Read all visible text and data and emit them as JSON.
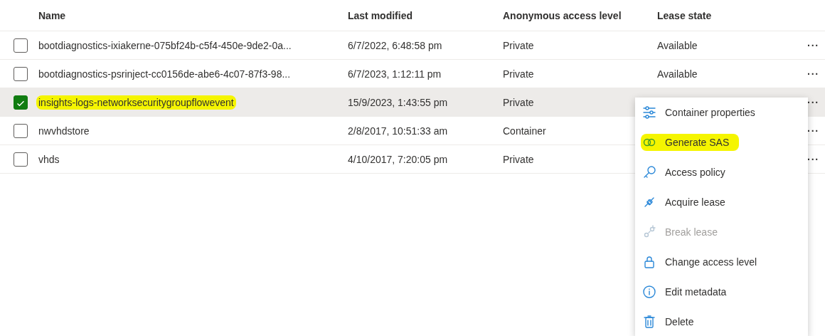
{
  "table": {
    "columns": [
      "Name",
      "Last modified",
      "Anonymous access level",
      "Lease state"
    ],
    "rows": [
      {
        "name": "bootdiagnostics-ixiakerne-075bf24b-c5f4-450e-9de2-0a...",
        "modified": "6/7/2022, 6:48:58 pm",
        "access": "Private",
        "lease": "Available",
        "more": "···",
        "selected": false,
        "highlighted": false
      },
      {
        "name": "bootdiagnostics-psrinject-cc0156de-abe6-4c07-87f3-98...",
        "modified": "6/7/2023, 1:12:11 pm",
        "access": "Private",
        "lease": "Available",
        "more": "···",
        "selected": false,
        "highlighted": false
      },
      {
        "name": "insights-logs-networksecuritygroupflowevent",
        "modified": "15/9/2023, 1:43:55 pm",
        "access": "Private",
        "more": "···",
        "selected": true,
        "highlighted": true
      },
      {
        "name": "nwvhdstore",
        "modified": "2/8/2017, 10:51:33 am",
        "access": "Container",
        "more": "···",
        "selected": false,
        "highlighted": false
      },
      {
        "name": "vhds",
        "modified": "4/10/2017, 7:20:05 pm",
        "access": "Private",
        "more": "···",
        "selected": false,
        "highlighted": false
      }
    ]
  },
  "context_menu": {
    "items": [
      {
        "label": "Container properties",
        "disabled": false,
        "highlighted": false
      },
      {
        "label": "Generate SAS",
        "disabled": false,
        "highlighted": true
      },
      {
        "label": "Access policy",
        "disabled": false,
        "highlighted": false
      },
      {
        "label": "Acquire lease",
        "disabled": false,
        "highlighted": false
      },
      {
        "label": "Break lease",
        "disabled": true,
        "highlighted": false
      },
      {
        "label": "Change access level",
        "disabled": false,
        "highlighted": false
      },
      {
        "label": "Edit metadata",
        "disabled": false,
        "highlighted": false
      },
      {
        "label": "Delete",
        "disabled": false,
        "highlighted": false
      }
    ]
  }
}
